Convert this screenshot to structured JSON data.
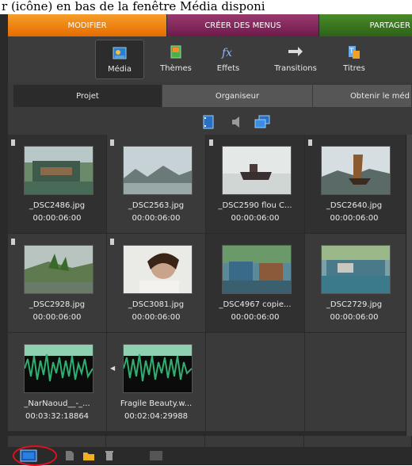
{
  "caption": "r (icône) en bas de la fenêtre Média disponi",
  "tabs": {
    "modifier": "MODIFIER",
    "creer_menus": "CRÉER DES MENUS",
    "partager": "PARTAGER"
  },
  "toolbar": {
    "media": "Média",
    "themes": "Thèmes",
    "effets": "Effets",
    "transitions": "Transitions",
    "titres": "Titres"
  },
  "subtabs": {
    "projet": "Projet",
    "organiseur": "Organiseur",
    "obtenir": "Obtenir le méd"
  },
  "media_items": [
    {
      "name": "_DSC2486.jpg",
      "duration": "00:00:06:00"
    },
    {
      "name": "_DSC2563.jpg",
      "duration": "00:00:06:00"
    },
    {
      "name": "_DSC2590 flou C...",
      "duration": "00:00:06:00"
    },
    {
      "name": "_DSC2640.jpg",
      "duration": "00:00:06:00"
    },
    {
      "name": "_DSC2928.jpg",
      "duration": "00:00:06:00"
    },
    {
      "name": "_DSC3081.jpg",
      "duration": "00:00:06:00"
    },
    {
      "name": "_DSC4967 copie...",
      "duration": "00:00:06:00"
    },
    {
      "name": "_DSC2729.jpg",
      "duration": "00:00:06:00"
    },
    {
      "name": "_NarNaoud__-_...",
      "duration": "00:03:32:18864"
    },
    {
      "name": "Fragile Beauty.w...",
      "duration": "00:02:04:29988"
    }
  ],
  "icons": {
    "media": "media-icon",
    "themes": "themes-icon",
    "effets": "fx-icon",
    "transitions": "arrows-icon",
    "titres": "titles-icon"
  },
  "colors": {
    "accent_orange": "#e46c00",
    "menus_purple": "#6e1a4a",
    "partager_green": "#2e6216",
    "highlight_red": "#e01020"
  }
}
